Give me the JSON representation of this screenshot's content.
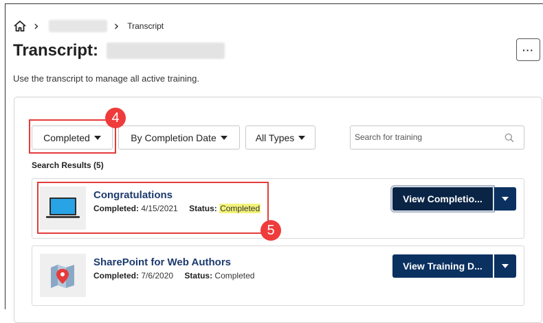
{
  "breadcrumb": {
    "home_icon": "home-icon",
    "separator_icon": "chevron-right-icon",
    "current": "Transcript"
  },
  "header": {
    "title": "Transcript:",
    "more_label": "···"
  },
  "description": "Use the transcript to manage all active training.",
  "filters": {
    "status": "Completed",
    "sort": "By Completion Date",
    "type": "All Types"
  },
  "search": {
    "placeholder": "Search for training"
  },
  "results": {
    "label": "Search Results (5)",
    "items": [
      {
        "title": "Congratulations",
        "completed_label": "Completed:",
        "completed_date": "4/15/2021",
        "status_label": "Status:",
        "status_value": "Completed",
        "action_label": "View Completio...",
        "thumbnail_icon": "laptop-icon"
      },
      {
        "title": "SharePoint for Web Authors",
        "completed_label": "Completed:",
        "completed_date": "7/6/2020",
        "status_label": "Status:",
        "status_value": "Completed",
        "action_label": "View Training D...",
        "thumbnail_icon": "map-pin-icon"
      }
    ]
  },
  "callouts": {
    "step_4": "4",
    "step_5": "5"
  },
  "colors": {
    "primary": "#0b3161",
    "link": "#1c3a6e",
    "callout": "#e53a3a",
    "highlight": "#f3f37a"
  }
}
